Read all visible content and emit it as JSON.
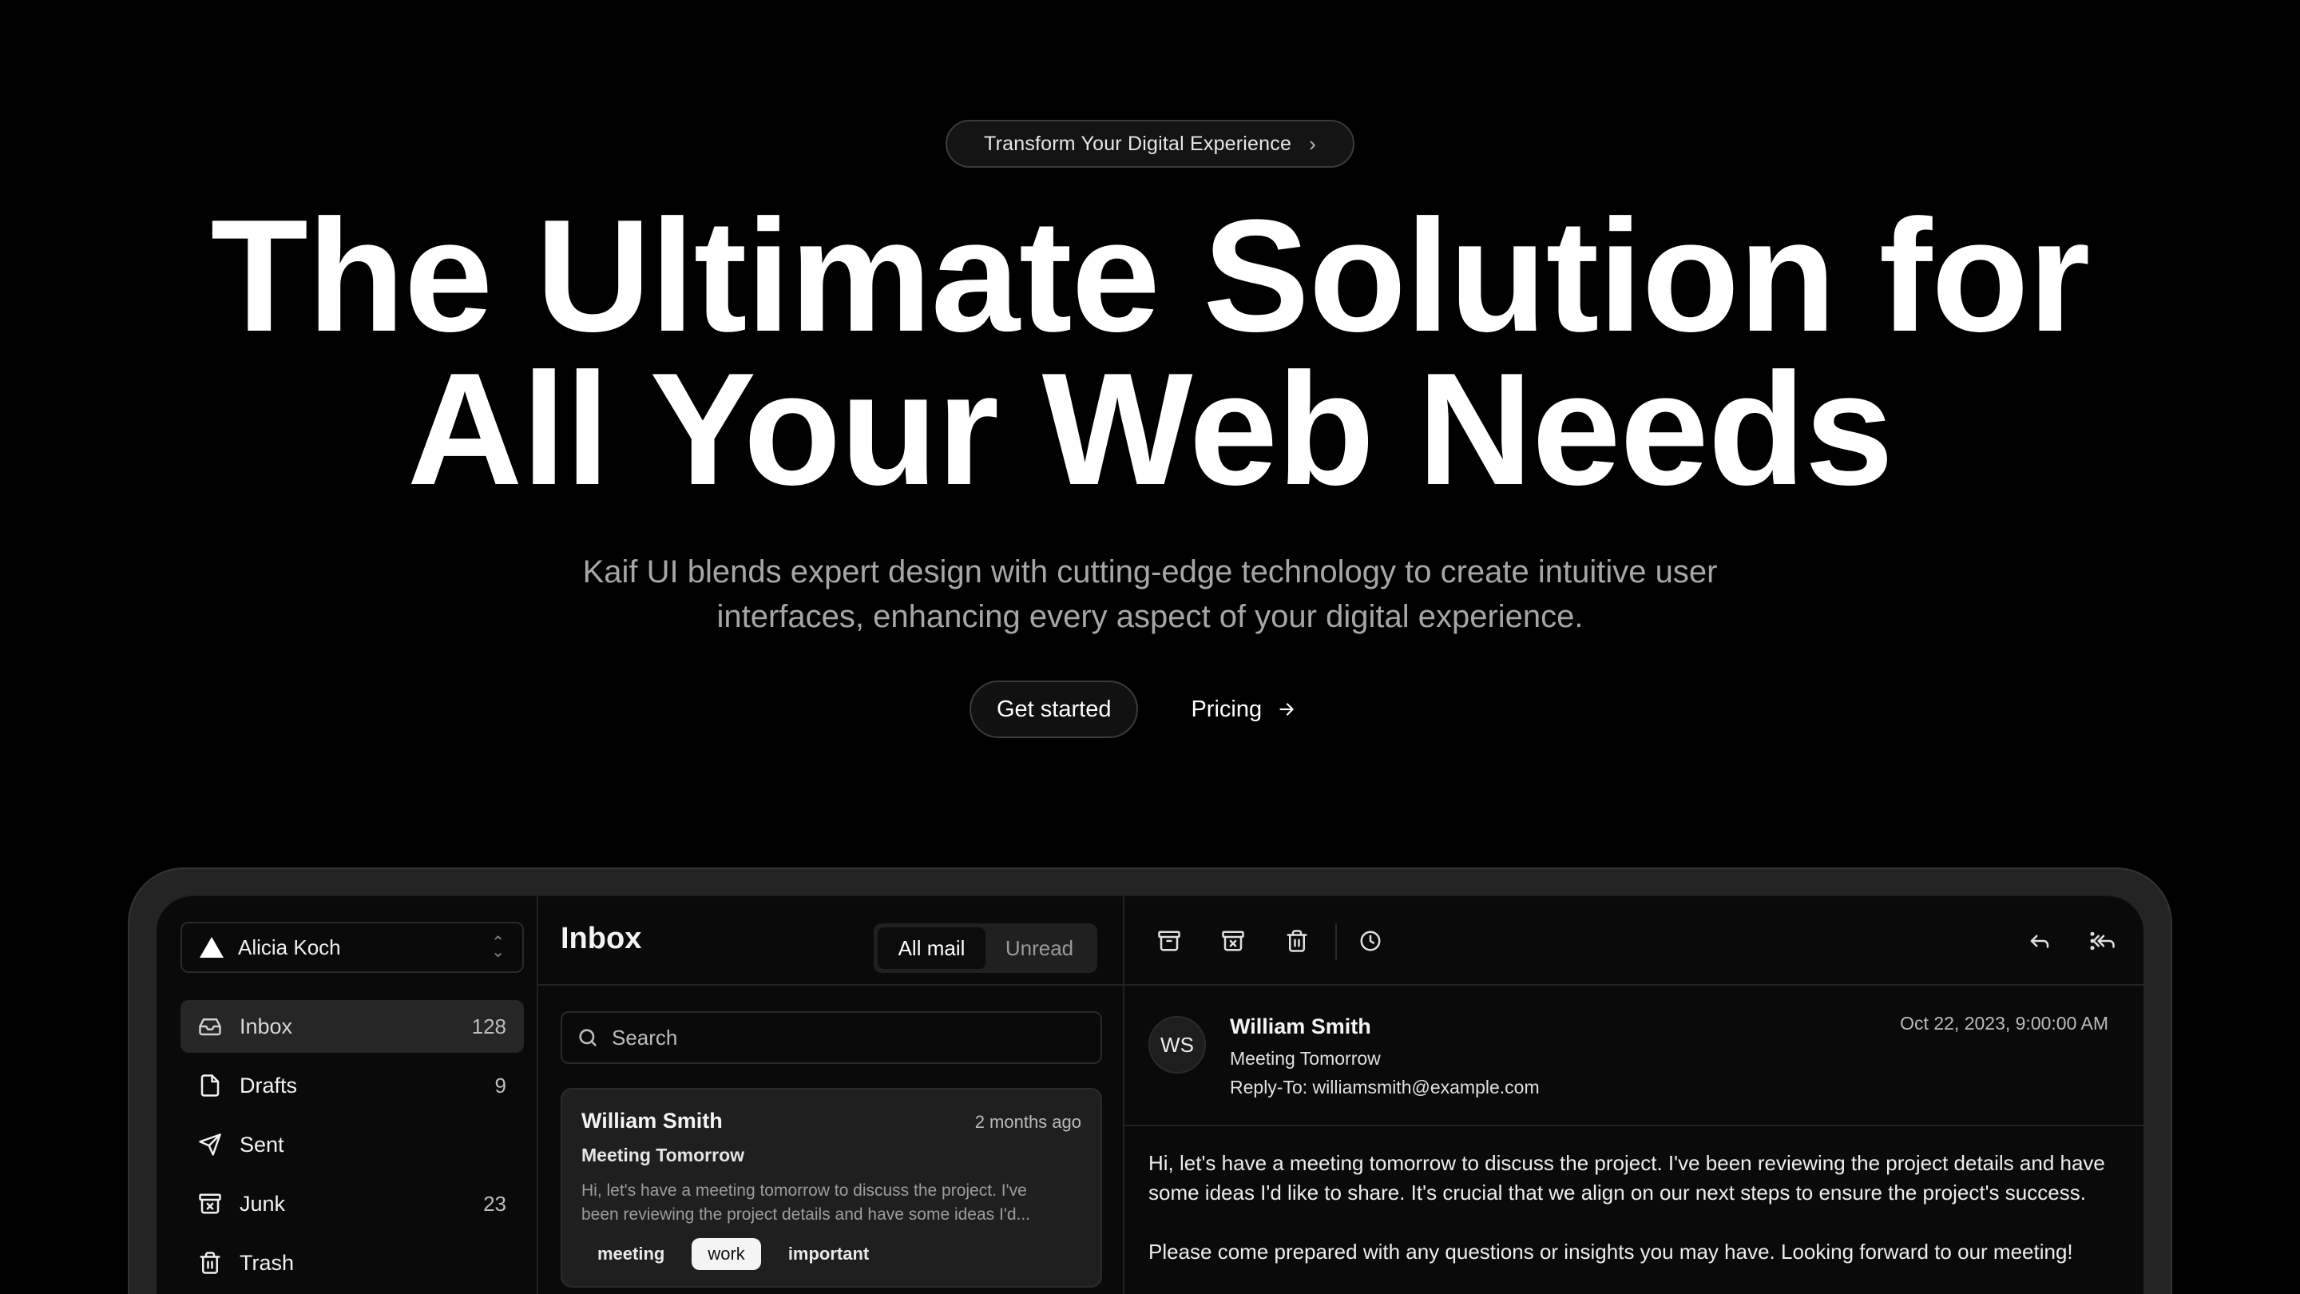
{
  "hero": {
    "badge": "Transform Your Digital Experience",
    "headline_line1": "The Ultimate Solution for",
    "headline_line2": "All Your Web Needs",
    "subtitle_line1": "Kaif UI blends expert design with cutting-edge technology to create intuitive user",
    "subtitle_line2": "interfaces, enhancing every aspect of your digital experience.",
    "primary_cta": "Get started",
    "secondary_cta": "Pricing"
  },
  "mail_app": {
    "account": {
      "name": "Alicia Koch"
    },
    "nav": [
      {
        "label": "Inbox",
        "count": "128",
        "icon": "inbox-icon",
        "active": true
      },
      {
        "label": "Drafts",
        "count": "9",
        "icon": "file-icon"
      },
      {
        "label": "Sent",
        "count": "",
        "icon": "send-icon"
      },
      {
        "label": "Junk",
        "count": "23",
        "icon": "archive-x-icon"
      },
      {
        "label": "Trash",
        "count": "",
        "icon": "trash-icon"
      }
    ],
    "list": {
      "title": "Inbox",
      "filters": [
        "All mail",
        "Unread"
      ],
      "active_filter": "All mail",
      "search_placeholder": "Search",
      "items": [
        {
          "from": "William Smith",
          "time": "2 months ago",
          "subject": "Meeting Tomorrow",
          "preview_line1": "Hi, let's have a meeting tomorrow to discuss the project. I've",
          "preview_line2": "been reviewing the project details and have some ideas I'd...",
          "tags": [
            "meeting",
            "work",
            "important"
          ],
          "highlighted_tag": "work"
        }
      ]
    },
    "message": {
      "initials": "WS",
      "from": "William Smith",
      "subject": "Meeting Tomorrow",
      "reply_to": "Reply-To: williamsmith@example.com",
      "date": "Oct 22, 2023, 9:00:00 AM",
      "body_p1": "Hi, let's have a meeting tomorrow to discuss the project. I've been reviewing the project details and have some ideas I'd like to share. It's crucial that we align on our next steps to ensure the project's success.",
      "body_p2": "Please come prepared with any questions or insights you may have. Looking forward to our meeting!"
    },
    "toolbar_icons": [
      "archive-icon",
      "archive-x-icon",
      "trash-icon",
      "clock-icon",
      "reply-icon",
      "reply-all-icon",
      "forward-icon",
      "more-vertical-icon"
    ]
  },
  "colors": {
    "background": "#000000",
    "surface": "#0a0a0a",
    "card": "#1f1f1f",
    "text_muted": "#a6a6a6"
  }
}
